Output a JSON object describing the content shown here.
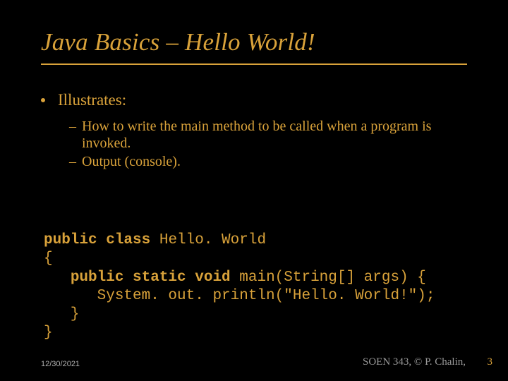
{
  "title": "Java Basics – Hello World!",
  "bullet1": "Illustrates:",
  "sub1": "How to write the main method to be called when a program is invoked.",
  "sub2": "Output (console).",
  "code": {
    "l1a": "public class",
    "l1b": " Hello. World",
    "l2": "{",
    "l3a": "   ",
    "l3b": "public static void",
    "l3c": " main(String[] args) {",
    "l4": "      System. out. println(\"Hello. World!\");",
    "l5": "   }",
    "l6": "}"
  },
  "footer": {
    "date": "12/30/2021",
    "credit": "SOEN 343, © P. Chalin,",
    "page": "3"
  }
}
